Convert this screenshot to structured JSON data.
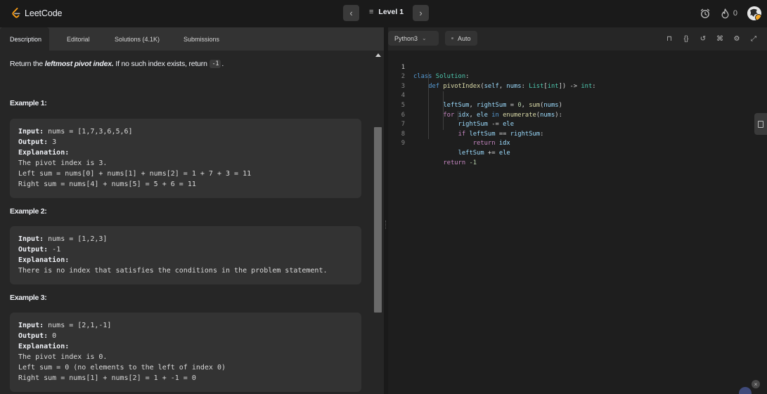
{
  "header": {
    "logo_text": "LeetCode",
    "level_label": "Level 1",
    "streak_count": "0",
    "icons": [
      "back-chevron-icon",
      "forward-chevron-icon",
      "list-icon",
      "alarm-icon",
      "fire-icon"
    ]
  },
  "tabs": [
    {
      "label": "Description",
      "active": true
    },
    {
      "label": "Editorial"
    },
    {
      "label": "Solutions (4.1K)"
    },
    {
      "label": "Submissions"
    }
  ],
  "description": {
    "intro_prefix": "Return the ",
    "intro_emphasis": "leftmost pivot index.",
    "intro_mid": " If no such index exists, return ",
    "intro_code": "-1",
    "intro_suffix": ".",
    "examples": [
      {
        "title": "Example 1:",
        "input_label": "Input:",
        "input": " nums = [1,7,3,6,5,6]",
        "output_label": "Output:",
        "output": " 3",
        "explanation_label": "Explanation:",
        "explanation": [
          "The pivot index is 3.",
          "Left sum = nums[0] + nums[1] + nums[2] = 1 + 7 + 3 = 11",
          "Right sum = nums[4] + nums[5] = 5 + 6 = 11"
        ]
      },
      {
        "title": "Example 2:",
        "input_label": "Input:",
        "input": " nums = [1,2,3]",
        "output_label": "Output:",
        "output": " -1",
        "explanation_label": "Explanation:",
        "explanation": [
          "There is no index that satisfies the conditions in the problem statement."
        ]
      },
      {
        "title": "Example 3:",
        "input_label": "Input:",
        "input": " nums = [2,1,-1]",
        "output_label": "Output:",
        "output": " 0",
        "explanation_label": "Explanation:",
        "explanation": [
          "The pivot index is 0.",
          "Left sum = 0 (no elements to the left of index 0)",
          "Right sum = nums[1] + nums[2] = 1 + -1 = 0"
        ]
      }
    ]
  },
  "editor": {
    "language": "Python3",
    "mode": "Auto",
    "tool_icons": [
      "bookmark-icon",
      "braces-icon",
      "reset-icon",
      "command-icon",
      "settings-icon",
      "expand-icon"
    ],
    "line_numbers": [
      "1",
      "2",
      "3",
      "4",
      "5",
      "6",
      "7",
      "8",
      "9"
    ],
    "code_lines": [
      "class Solution:",
      "    def pivotIndex(self, nums: List[int]) -> int:",
      "        leftSum, rightSum = 0, sum(nums)",
      "        for idx, ele in enumerate(nums):",
      "            rightSum -= ele",
      "            if leftSum == rightSum:",
      "                return idx",
      "            leftSum += ele",
      "        return -1"
    ]
  }
}
